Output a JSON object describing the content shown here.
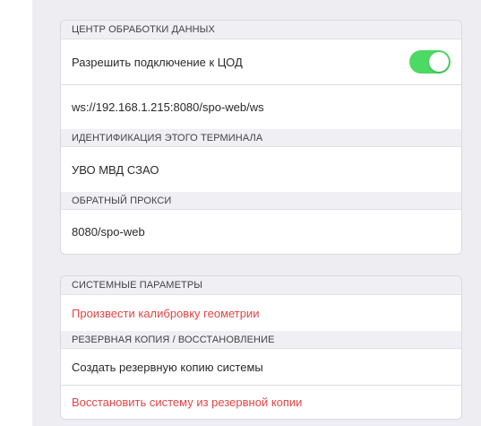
{
  "dpc_section": {
    "header": "ЦЕНТР ОБРАБОТКИ ДАННЫХ",
    "allow_connection_label": "Разрешить подключение к ЦОД",
    "allow_connection_enabled": true,
    "server_url": "ws://192.168.1.215:8080/spo-web/ws"
  },
  "terminal_id_section": {
    "header": "ИДЕНТИФИКАЦИЯ ЭТОГО ТЕРМИНАЛА",
    "value": "УВО МВД СЗАО"
  },
  "reverse_proxy_section": {
    "header": "ОБРАТНЫЙ ПРОКСИ",
    "value": "8080/spo-web"
  },
  "system_params_section": {
    "header": "СИСТЕМНЫЕ ПАРАМЕТРЫ",
    "calibrate_label": "Произвести калибровку геометрии"
  },
  "backup_section": {
    "header": "РЕЗЕРВНАЯ КОПИЯ / ВОССТАНОВЛЕНИЕ",
    "create_backup_label": "Создать резервную копию системы",
    "restore_label": "Восстановить систему из резервной копии"
  },
  "colors": {
    "toggle_on": "#4cd964",
    "destructive": "#e04646",
    "header_bg": "#efeff4",
    "page_bg": "#ededf2"
  }
}
